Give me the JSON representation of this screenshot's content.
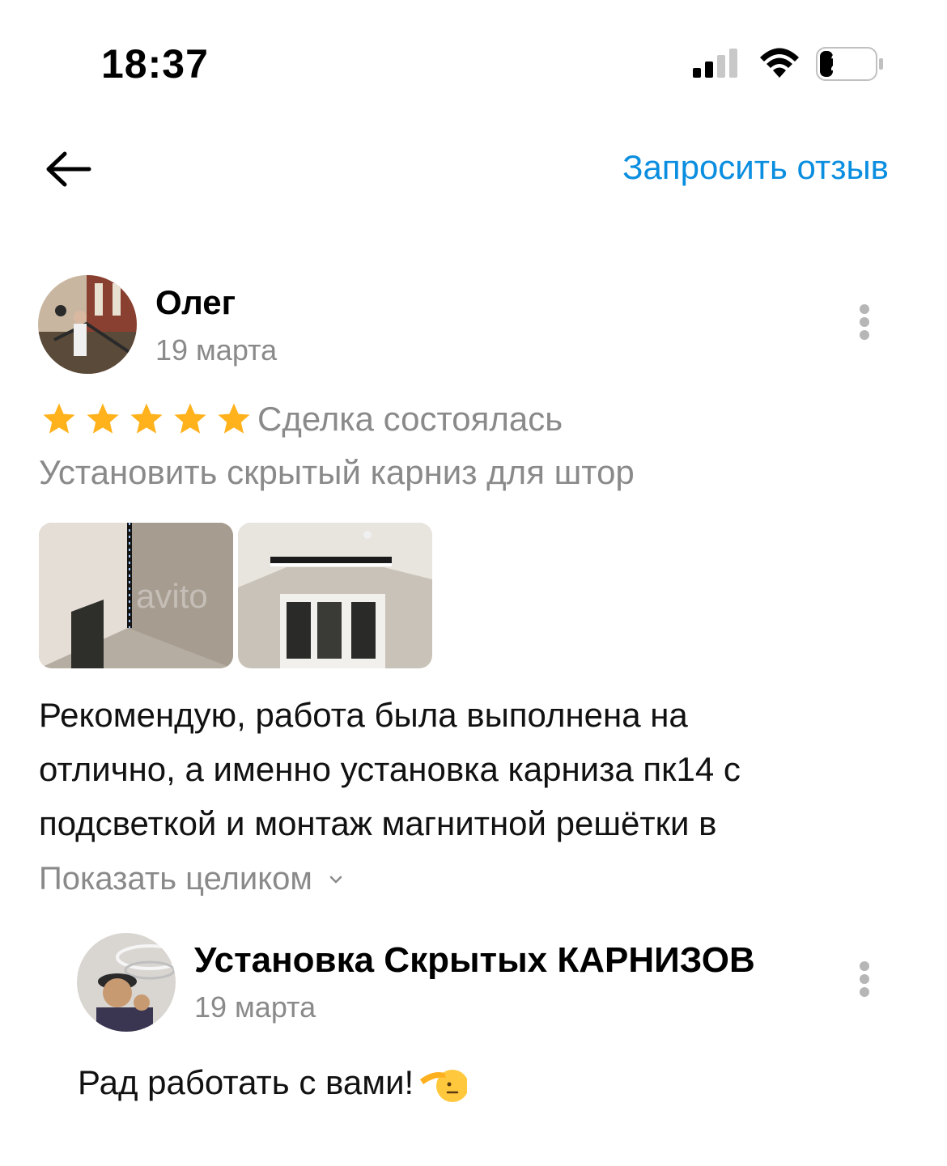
{
  "status_bar": {
    "time": "18:37",
    "battery_level": "21"
  },
  "header": {
    "back_icon": "arrow-left-icon",
    "request_review_label": "Запросить отзыв"
  },
  "review": {
    "author": "Олег",
    "date": "19 марта",
    "rating": 5,
    "rating_max": 5,
    "deal_status": "Сделка состоялась",
    "service": "Установить скрытый карниз для штор",
    "photos": [
      "photo-1",
      "photo-2"
    ],
    "text_lines": [
      "Рекомендую, работа была выполнена на",
      "отлично, а именно установка карниза пк14 с",
      "подсветкой и монтаж магнитной решётки в"
    ],
    "show_more_label": "Показать целиком"
  },
  "reply": {
    "author": "Установка Скрытых КАРНИЗОВ",
    "date": "19 марта",
    "text": "Рад работать с вами!"
  },
  "colors": {
    "accent": "#0a8ee0",
    "star": "#ffb21c",
    "secondary_text": "#8a8a8a"
  }
}
